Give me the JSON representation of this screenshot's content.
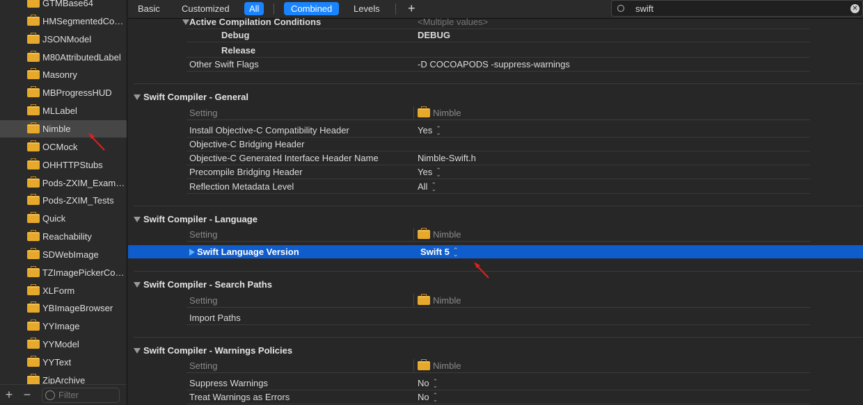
{
  "sidebar": {
    "items": [
      {
        "label": "GTMBase64"
      },
      {
        "label": "HMSegmentedCon..."
      },
      {
        "label": "JSONModel"
      },
      {
        "label": "M80AttributedLabel"
      },
      {
        "label": "Masonry"
      },
      {
        "label": "MBProgressHUD"
      },
      {
        "label": "MLLabel"
      },
      {
        "label": "Nimble",
        "selected": true
      },
      {
        "label": "OCMock"
      },
      {
        "label": "OHHTTPStubs"
      },
      {
        "label": "Pods-ZXIM_Example"
      },
      {
        "label": "Pods-ZXIM_Tests"
      },
      {
        "label": "Quick"
      },
      {
        "label": "Reachability"
      },
      {
        "label": "SDWebImage"
      },
      {
        "label": "TZImagePickerCon..."
      },
      {
        "label": "XLForm"
      },
      {
        "label": "YBImageBrowser"
      },
      {
        "label": "YYImage"
      },
      {
        "label": "YYModel"
      },
      {
        "label": "YYText"
      },
      {
        "label": "ZipArchive"
      }
    ],
    "add_label": "+",
    "remove_label": "−",
    "filter_placeholder": "Filter"
  },
  "toolbar": {
    "basic": "Basic",
    "customized": "Customized",
    "all": "All",
    "combined": "Combined",
    "levels": "Levels",
    "add": "+",
    "search_value": "swift"
  },
  "main": {
    "rows": [
      {
        "type": "b",
        "key": "Active Compilation Conditions",
        "value": "<Multiple values>",
        "muted": true,
        "tri": true
      },
      {
        "type": "ind",
        "key": "Debug",
        "value": "DEBUG",
        "boldval": true
      },
      {
        "type": "ind",
        "key": "Release",
        "value": ""
      },
      {
        "type": "n",
        "key": "Other Swift Flags",
        "value": "-D COCOAPODS  -suppress-warnings"
      },
      {
        "type": "hdr",
        "key": "Swift Compiler - General"
      },
      {
        "type": "setting",
        "key": "Setting",
        "value": "Nimble"
      },
      {
        "type": "n",
        "key": "Install Objective-C Compatibility Header",
        "value": "Yes",
        "stepper": true
      },
      {
        "type": "n",
        "key": "Objective-C Bridging Header",
        "value": ""
      },
      {
        "type": "n",
        "key": "Objective-C Generated Interface Header Name",
        "value": "Nimble-Swift.h"
      },
      {
        "type": "n",
        "key": "Precompile Bridging Header",
        "value": "Yes",
        "stepper": true
      },
      {
        "type": "n",
        "key": "Reflection Metadata Level",
        "value": "All",
        "stepper": true
      },
      {
        "type": "hdr",
        "key": "Swift Compiler - Language"
      },
      {
        "type": "setting",
        "key": "Setting",
        "value": "Nimble"
      },
      {
        "type": "sel",
        "key": "Swift Language Version",
        "value": "Swift 5",
        "stepper": true
      },
      {
        "type": "hdr",
        "key": "Swift Compiler - Search Paths"
      },
      {
        "type": "setting",
        "key": "Setting",
        "value": "Nimble"
      },
      {
        "type": "n",
        "key": "Import Paths",
        "value": ""
      },
      {
        "type": "hdr",
        "key": "Swift Compiler - Warnings Policies"
      },
      {
        "type": "setting",
        "key": "Setting",
        "value": "Nimble"
      },
      {
        "type": "n",
        "key": "Suppress Warnings",
        "value": "No",
        "stepper": true
      },
      {
        "type": "n",
        "key": "Treat Warnings as Errors",
        "value": "No",
        "stepper": true
      }
    ]
  },
  "colors": {
    "selection": "#0f5dcc",
    "accent": "#1a84ff",
    "annotation_arrow": "#e02020"
  }
}
